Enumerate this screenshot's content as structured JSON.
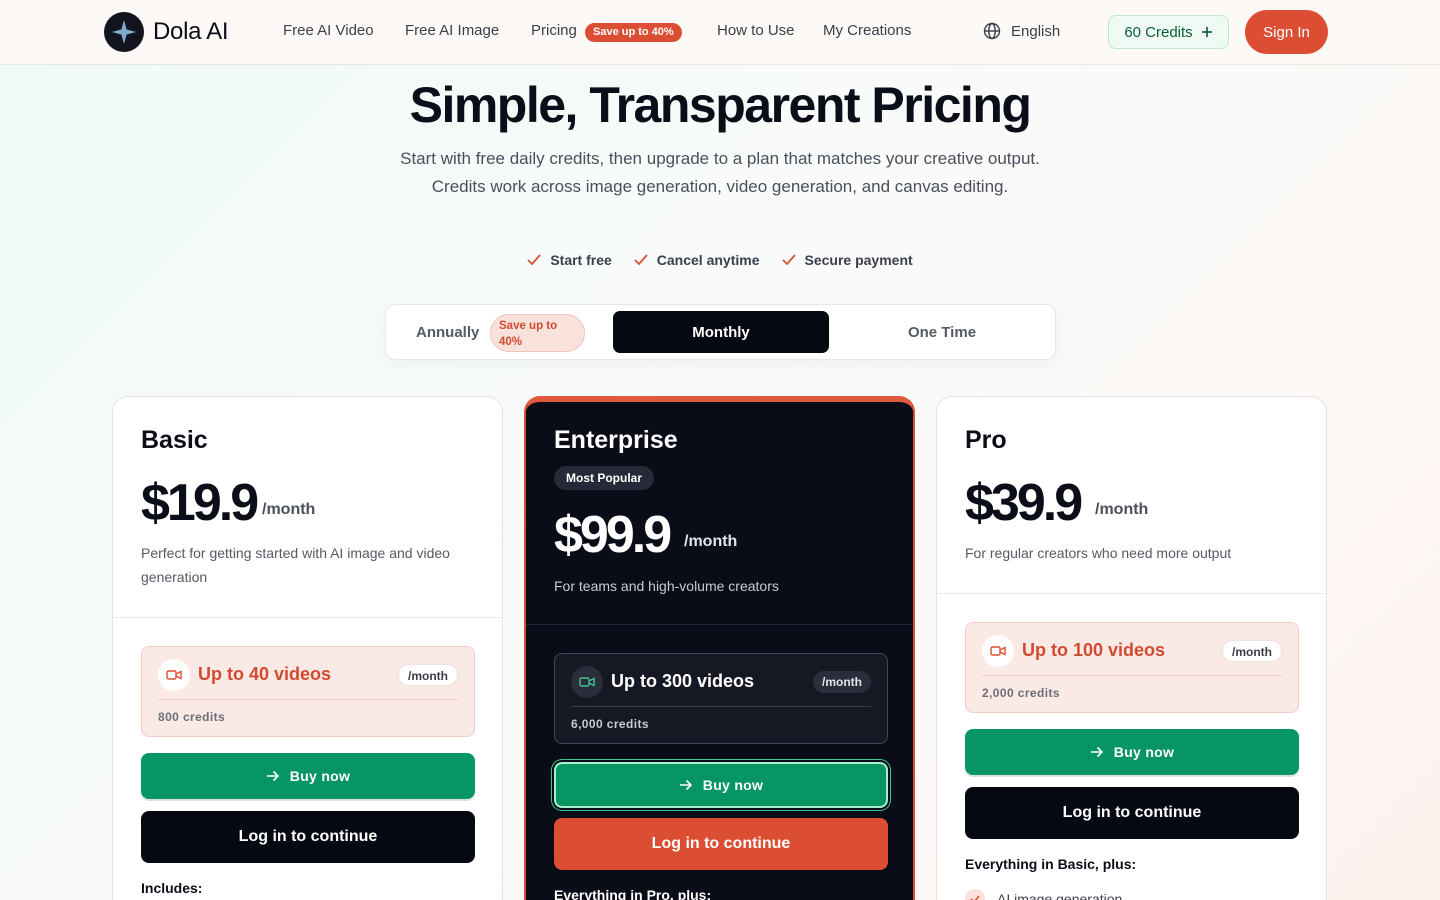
{
  "header": {
    "brand": "Dola AI",
    "nav": [
      "Free AI Video",
      "Free AI Image",
      "Pricing",
      "How to Use",
      "My Creations"
    ],
    "pricing_badge": "Save up to 40%",
    "language": "English",
    "credits": "60 Credits",
    "sign_in": "Sign In"
  },
  "hero": {
    "title": "Simple, Transparent Pricing",
    "subtitle": "Start with free daily credits, then upgrade to a plan that matches your creative output. Credits work across image generation, video generation, and canvas editing.",
    "features": [
      "Start free",
      "Cancel anytime",
      "Secure payment"
    ]
  },
  "billing_toggle": {
    "annually": "Annually",
    "annual_badge": "Save up to 40%",
    "monthly": "Monthly",
    "one_time": "One Time",
    "selected": "Monthly"
  },
  "plans": [
    {
      "name": "Basic",
      "price": "$19.9",
      "period": "/month",
      "description": "Perfect for getting started with AI image and video generation",
      "quota": "Up to 40 videos",
      "quota_period": "/month",
      "credits": "800 credits",
      "buy": "Buy now",
      "login": "Log in to continue",
      "includes": "Includes:"
    },
    {
      "name": "Enterprise",
      "badge": "Most Popular",
      "price": "$99.9",
      "period": "/month",
      "description": "For teams and high-volume creators",
      "quota": "Up to 300 videos",
      "quota_period": "/month",
      "credits": "6,000 credits",
      "buy": "Buy now",
      "login": "Log in to continue",
      "includes": "Everything in Pro, plus:"
    },
    {
      "name": "Pro",
      "price": "$39.9",
      "period": "/month",
      "description": "For regular creators who need more output",
      "quota": "Up to 100 videos",
      "quota_period": "/month",
      "credits": "2,000 credits",
      "buy": "Buy now",
      "login": "Log in to continue",
      "includes": "Everything in Basic, plus:",
      "features": [
        "AI image generation"
      ]
    }
  ],
  "colors": {
    "accent": "#dc4e34",
    "buy_green": "#079564",
    "dark": "#0a0c18"
  },
  "icons": {
    "logo": "sparkle-star-icon",
    "language": "globe-icon",
    "credits_add": "plus-icon",
    "feature_check": "check-icon",
    "quota": "video-camera-icon",
    "buy": "arrow-right-icon"
  }
}
